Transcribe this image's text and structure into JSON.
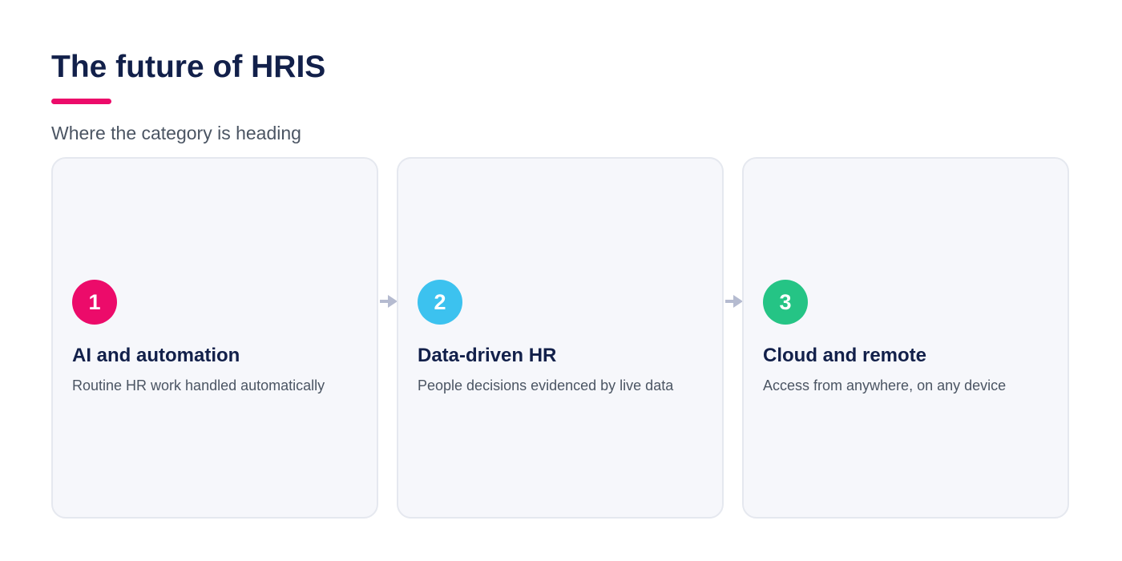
{
  "title": "The future of HRIS",
  "subtitle": "Where the category is heading",
  "colors": {
    "title": "#12204a",
    "accent": "#ec0b6a",
    "arrow": "#b5bbd0"
  },
  "steps": [
    {
      "number": "1",
      "title": "AI and automation",
      "description": "Routine HR work handled automatically",
      "color": "#ec0b6a"
    },
    {
      "number": "2",
      "title": "Data-driven HR",
      "description": "People decisions evidenced by live data",
      "color": "#3cc2ef"
    },
    {
      "number": "3",
      "title": "Cloud and remote",
      "description": "Access from anywhere, on any device",
      "color": "#25c485"
    }
  ],
  "connector_icon": "arrow-right-icon"
}
